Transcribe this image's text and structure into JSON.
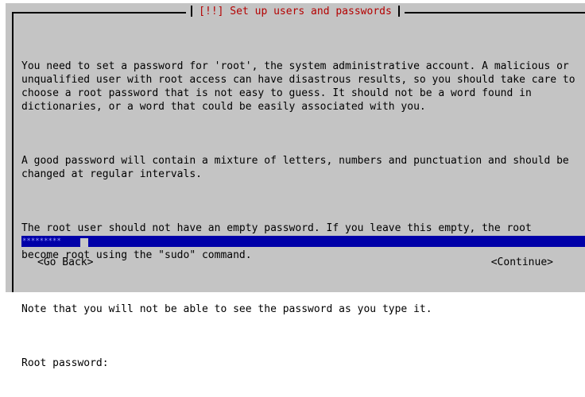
{
  "dialog": {
    "title": "[!!] Set up users and passwords",
    "paragraphs": [
      "You need to set a password for 'root', the system administrative account. A malicious or\nunqualified user with root access can have disastrous results, so you should take care to\nchoose a root password that is not easy to guess. It should not be a word found in\ndictionaries, or a word that could be easily associated with you.",
      "A good password will contain a mixture of letters, numbers and punctuation and should be\nchanged at regular intervals.",
      "The root user should not have an empty password. If you leave this empty, the root\naccount will be disabled and the system's initial user account will be given the power to\nbecome root using the \"sudo\" command.",
      "Note that you will not be able to see the password as you type it."
    ],
    "prompt_label": "Root password:",
    "password_masked": "*********",
    "buttons": {
      "back": "<Go Back>",
      "continue": "<Continue>"
    }
  },
  "colors": {
    "dialog_background": "#c4c4c4",
    "title_text": "#b40000",
    "input_background": "#0000a8",
    "input_text": "#9c9cff"
  }
}
